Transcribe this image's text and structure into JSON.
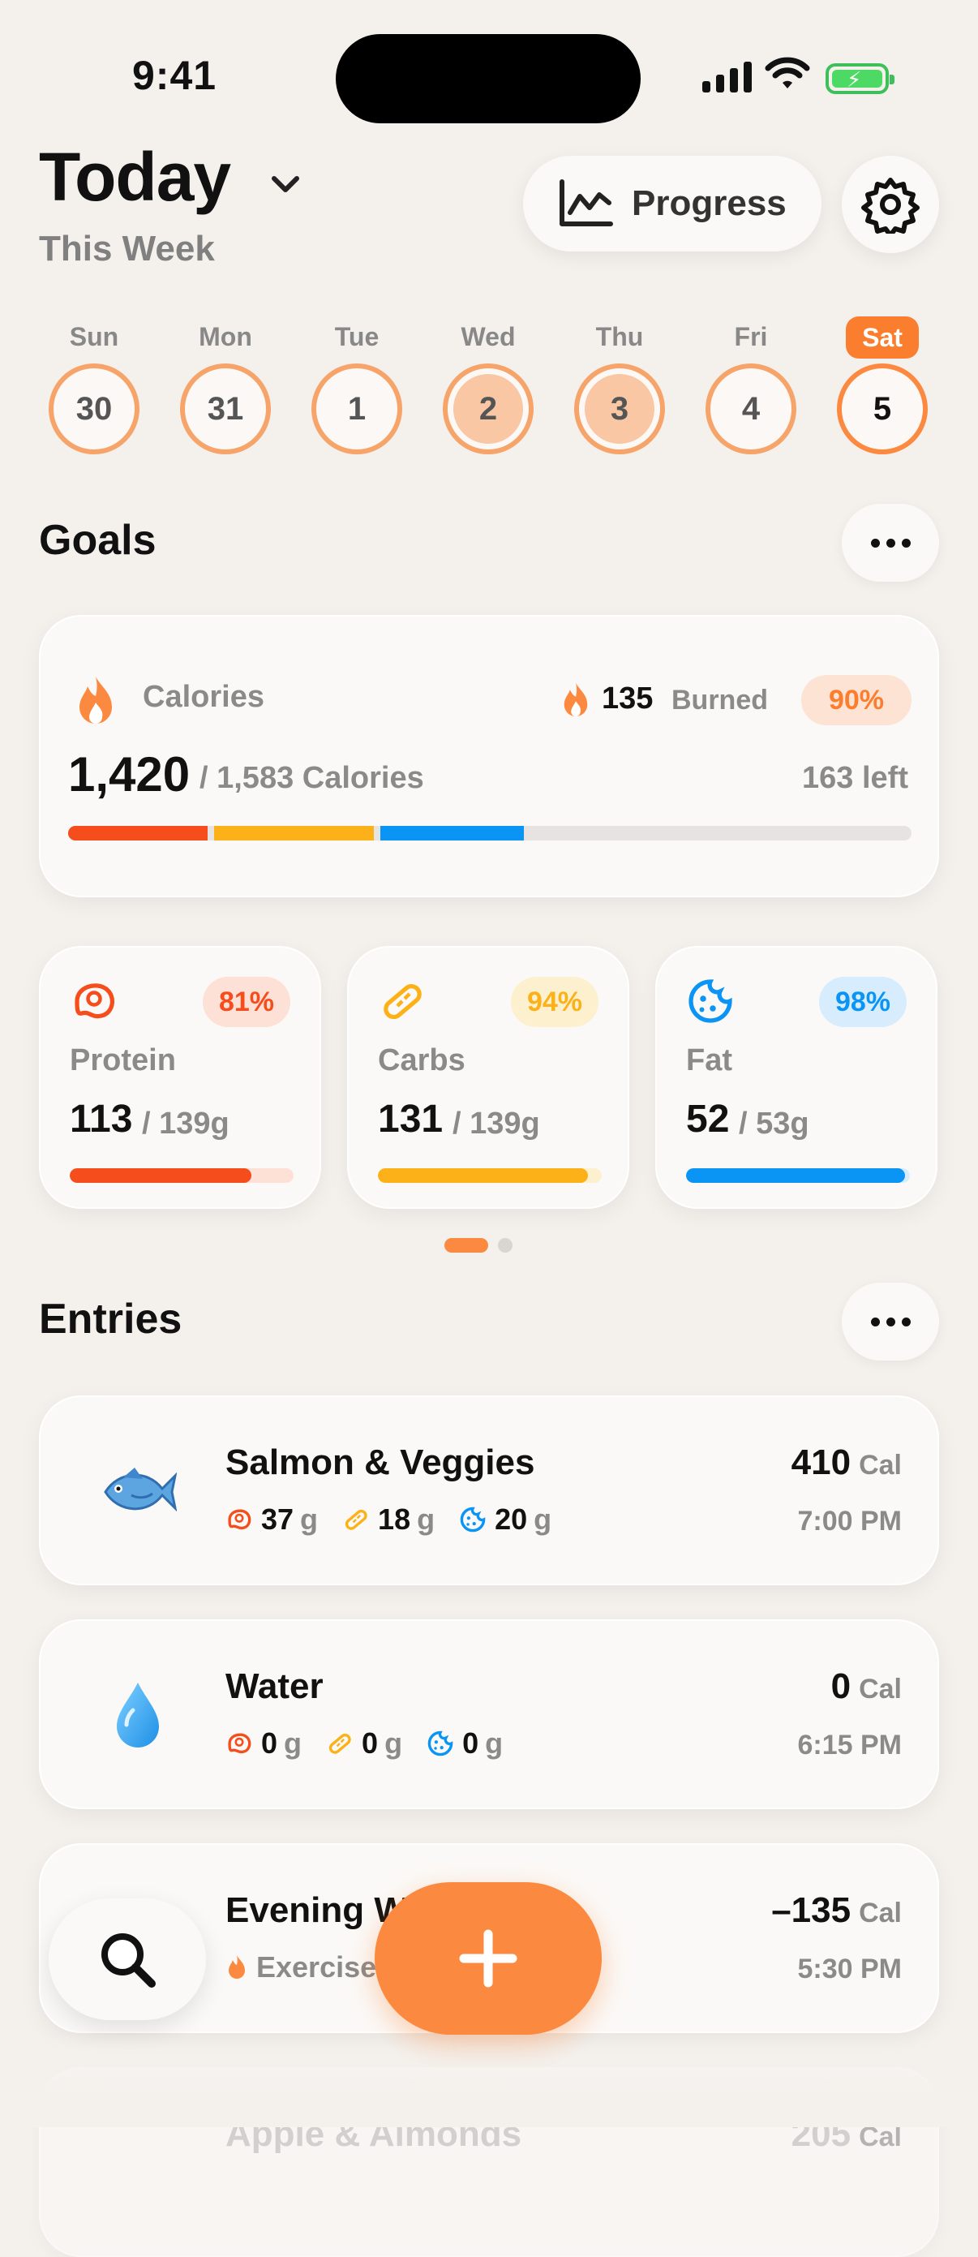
{
  "status_bar": {
    "time": "9:41"
  },
  "header": {
    "title": "Today",
    "subtitle": "This Week",
    "progress_label": "Progress"
  },
  "week": {
    "days": [
      {
        "name": "Sun",
        "date": "30",
        "state": "partial"
      },
      {
        "name": "Mon",
        "date": "31",
        "state": "partial"
      },
      {
        "name": "Tue",
        "date": "1",
        "state": "partial"
      },
      {
        "name": "Wed",
        "date": "2",
        "state": "filled"
      },
      {
        "name": "Thu",
        "date": "3",
        "state": "filled"
      },
      {
        "name": "Fri",
        "date": "4",
        "state": "partial"
      },
      {
        "name": "Sat",
        "date": "5",
        "state": "selected"
      }
    ]
  },
  "goals": {
    "title": "Goals",
    "calories": {
      "label": "Calories",
      "burned_value": "135",
      "burned_label": "Burned",
      "percent": "90%",
      "consumed": "1,420",
      "goal_text": "/ 1,583 Calories",
      "left_text": "163 left",
      "bar_segments": [
        {
          "color": "#f54d1c",
          "fraction": 0.165
        },
        {
          "color": "#fbb117",
          "fraction": 0.19
        },
        {
          "color": "#0a95f5",
          "fraction": 0.17
        }
      ]
    },
    "macros": [
      {
        "name": "Protein",
        "value": "113",
        "goal": "/ 139g",
        "percent": "81%",
        "fraction": 0.81,
        "color": "#f54d1c",
        "track": "#fde0d6",
        "badge_bg": "#fde0d6",
        "icon": "steak-icon"
      },
      {
        "name": "Carbs",
        "value": "131",
        "goal": "/ 139g",
        "percent": "94%",
        "fraction": 0.94,
        "color": "#fbb117",
        "track": "#fdf0cf",
        "badge_bg": "#fdf0cf",
        "icon": "bread-icon"
      },
      {
        "name": "Fat",
        "value": "52",
        "goal": "/ 53g",
        "percent": "98%",
        "fraction": 0.98,
        "color": "#0a95f5",
        "track": "#d7ecfd",
        "badge_bg": "#d7ecfd",
        "icon": "cookie-icon"
      }
    ]
  },
  "entries": {
    "title": "Entries",
    "items": [
      {
        "name": "Salmon & Veggies",
        "calories": "410",
        "unit": "Cal",
        "time": "7:00 PM",
        "icon": "fish-icon",
        "protein": "37",
        "carbs": "18",
        "fat": "20",
        "g": "g"
      },
      {
        "name": "Water",
        "calories": "0",
        "unit": "Cal",
        "time": "6:15 PM",
        "icon": "droplet-icon",
        "protein": "0",
        "carbs": "0",
        "fat": "0",
        "g": "g"
      },
      {
        "name": "Evening W",
        "calories": "–135",
        "unit": "Cal",
        "time": "5:30 PM",
        "icon": "exercise-icon",
        "subtitle": "Exercise"
      }
    ],
    "partial_next": {
      "name": "Apple & Almonds",
      "calories": "205",
      "unit": "Cal"
    }
  },
  "colors": {
    "accent": "#fb7d2e",
    "protein": "#f54d1c",
    "carbs": "#fbb117",
    "fat": "#0a95f5"
  }
}
